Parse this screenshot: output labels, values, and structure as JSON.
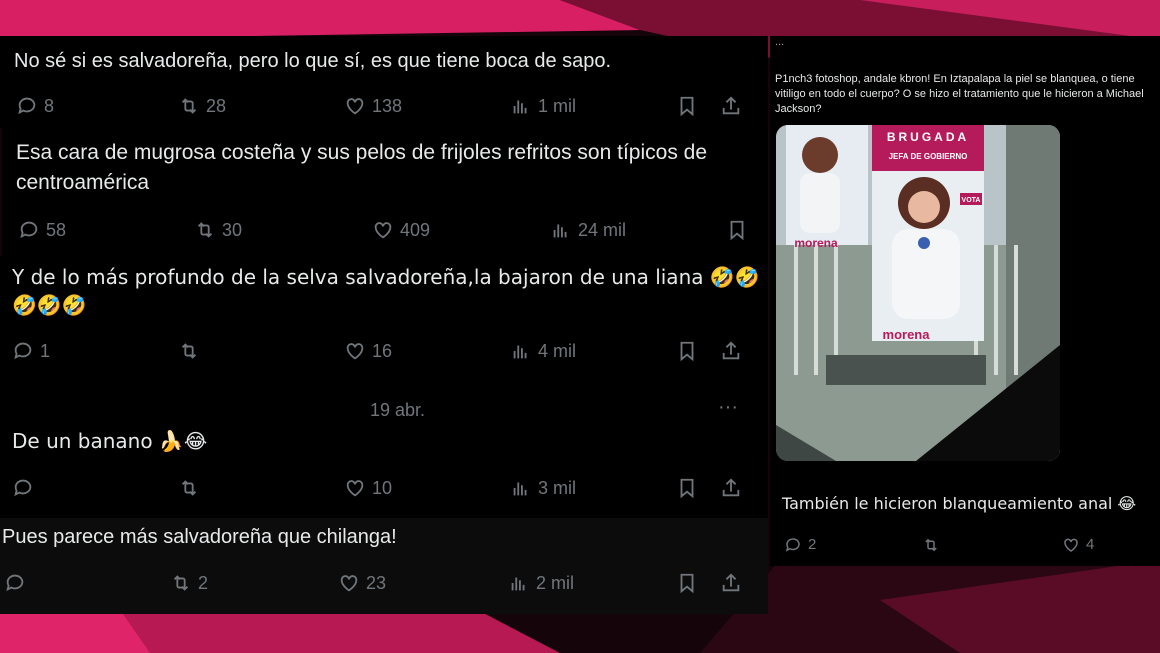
{
  "colors": {
    "accent": "#e0246a",
    "card_bg": "#000000",
    "text": "#e7e9ea",
    "muted": "#71767b"
  },
  "tweets": [
    {
      "text_lines": [
        "No sé si es salvadoreña, pero lo que sí, es que tiene boca de sapo."
      ],
      "replies": "8",
      "retweets": "28",
      "likes": "138",
      "views": "1 mil"
    },
    {
      "text_lines": [
        "Esa cara de mugrosa costeña y sus pelos de frijoles refritos son típicos de",
        "centroamérica"
      ],
      "replies": "58",
      "retweets": "30",
      "likes": "409",
      "views": "24 mil"
    },
    {
      "text_lines": [
        "Y de lo más profundo de la selva salvadoreña,la bajaron de una liana 🤣🤣",
        "🤣🤣🤣"
      ],
      "replies": "1",
      "retweets": "",
      "likes": "16",
      "views": "4 mil"
    },
    {
      "date": "19 abr.",
      "more": "···",
      "text_lines": [
        "De un banano 🍌😂"
      ],
      "replies": "",
      "retweets": "",
      "likes": "10",
      "views": "3 mil"
    },
    {
      "text_lines": [
        "Pues parece más salvadoreña que chilanga!"
      ],
      "replies": "",
      "retweets": "2",
      "likes": "23",
      "views": "2 mil"
    }
  ],
  "side_tweet": {
    "user": "...",
    "body": "P1nch3 fotoshop, andale kbron! En Iztapalapa la piel se blanquea, o tiene vitiligo en todo el cuerpo? O se hizo el tratamiento que le hicieron a Michael Jackson?",
    "photo": {
      "banner_top": "BRUGADA",
      "banner_sub": "JEFA DE GOBIERNO",
      "party": "morena",
      "vote": "VOTA"
    },
    "caption": "También le hicieron blanqueamiento anal 😂",
    "replies": "2",
    "likes": "4"
  }
}
